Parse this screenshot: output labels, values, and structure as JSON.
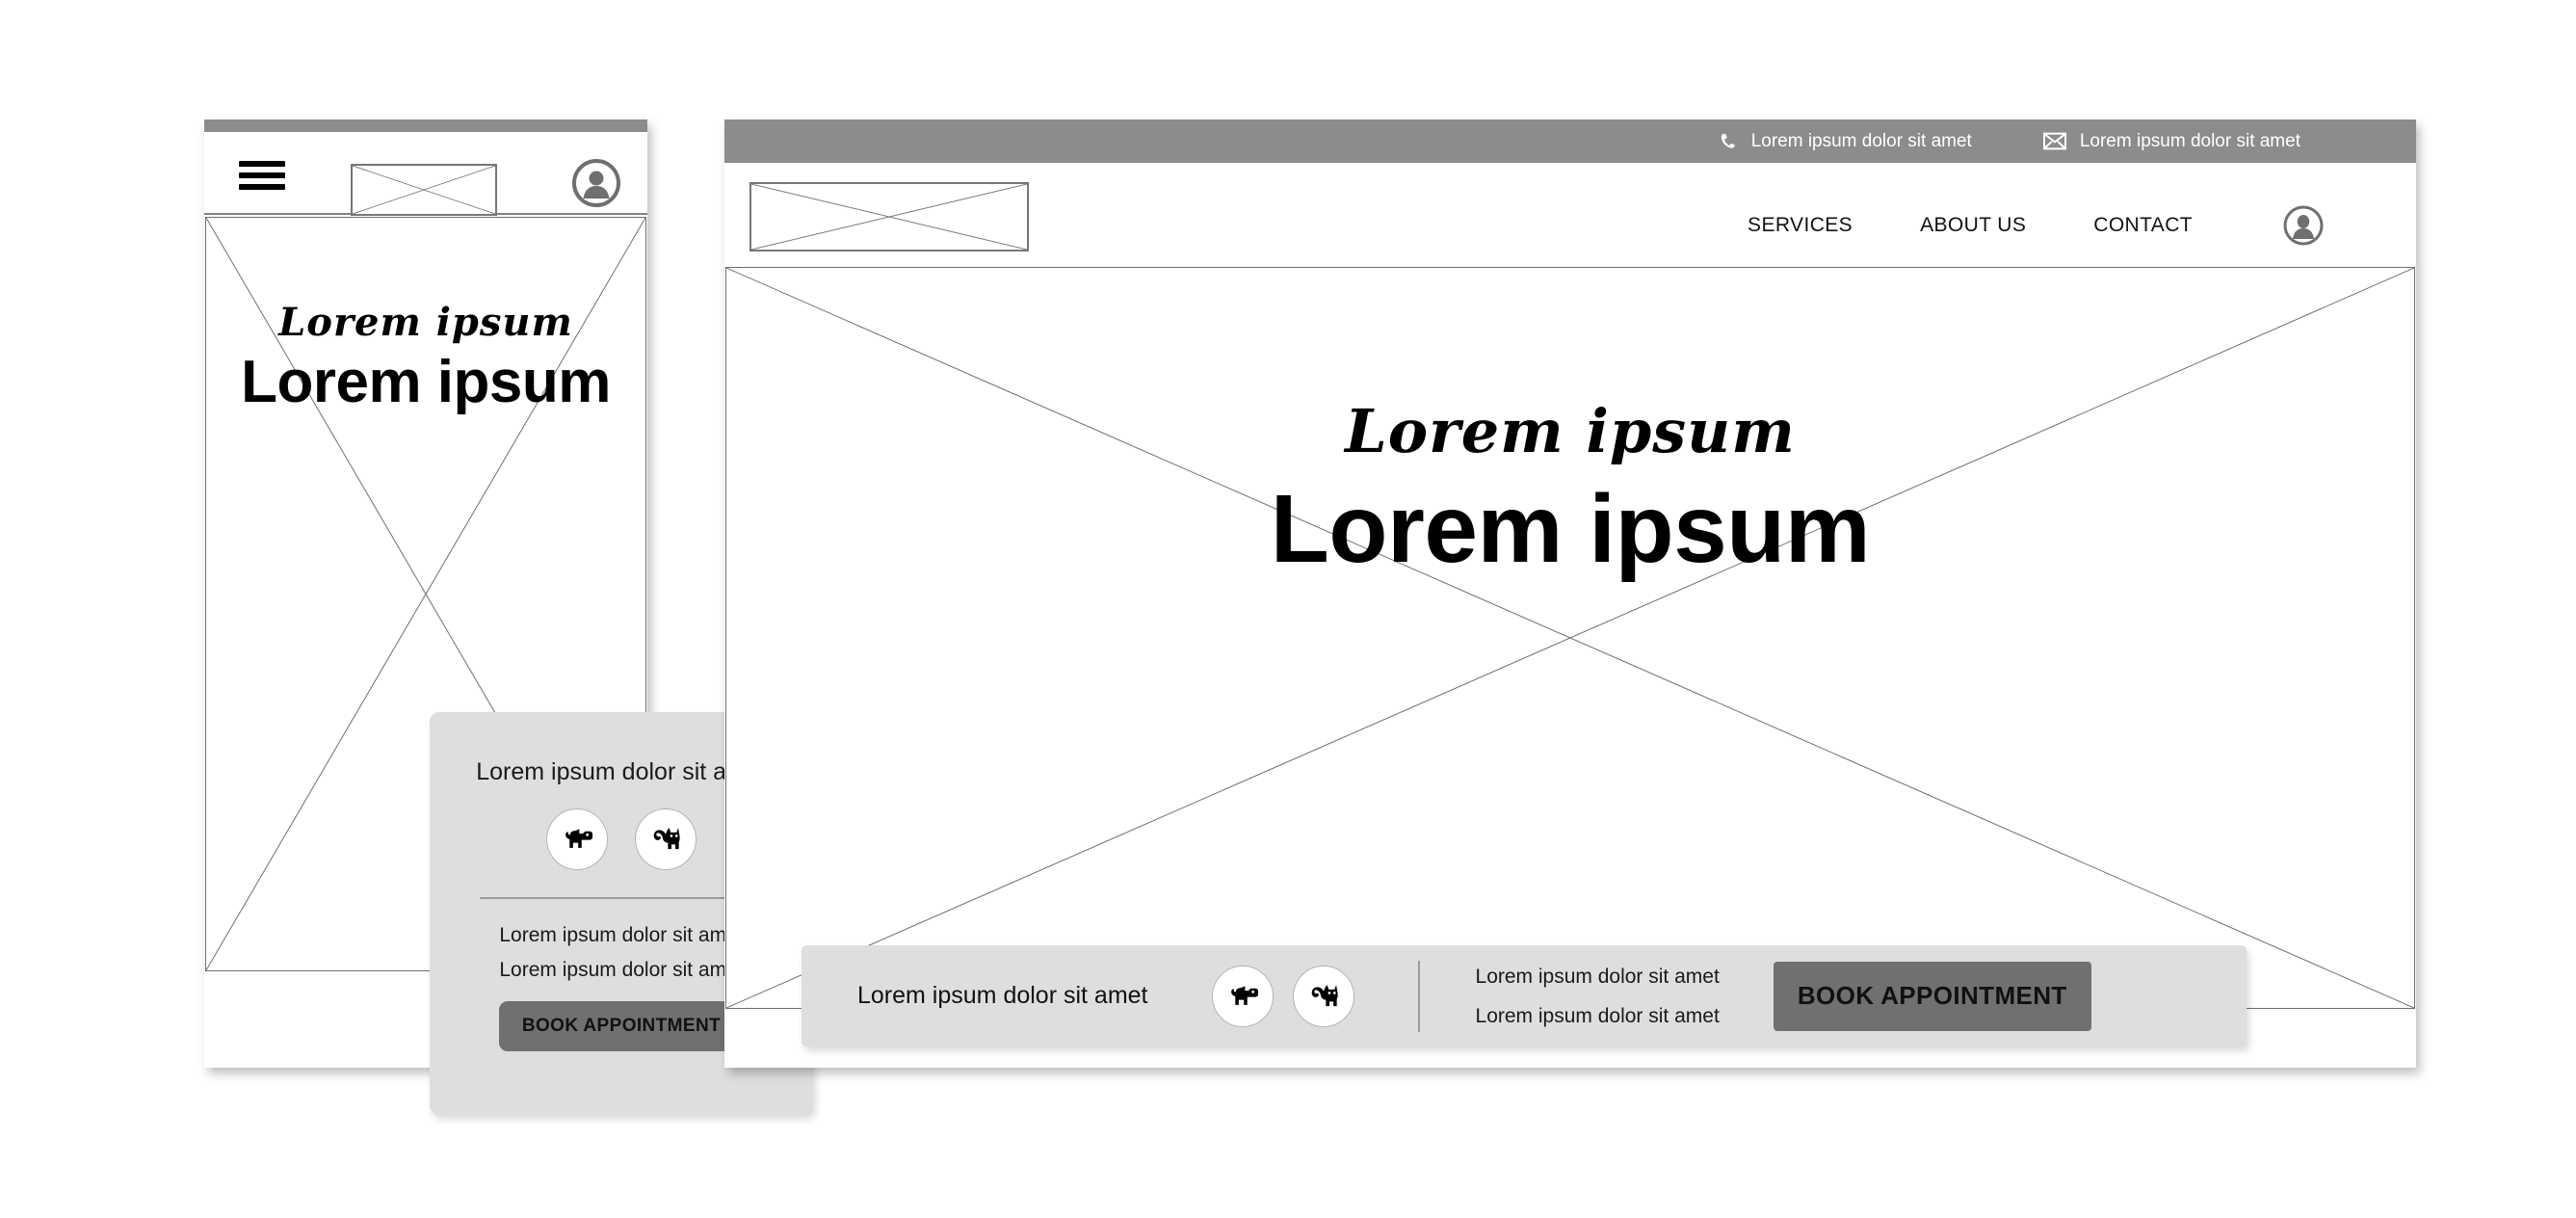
{
  "mobile": {
    "header": {
      "menu_icon": "hamburger-icon",
      "logo_placeholder": "image-placeholder",
      "avatar_icon": "user-avatar-icon"
    },
    "hero": {
      "script_heading": "Lorem ipsum",
      "bold_heading": "Lorem ipsum"
    },
    "card": {
      "title": "Lorem ipsum dolor sit amet",
      "pets": [
        {
          "icon": "dog-icon",
          "label": "Dog"
        },
        {
          "icon": "cat-icon",
          "label": "Cat"
        }
      ],
      "lines": [
        "Lorem ipsum dolor sit amet",
        "Lorem ipsum dolor sit amet"
      ],
      "book_button": "BOOK APPOINTMENT"
    }
  },
  "desktop": {
    "topbar": {
      "contacts": [
        {
          "icon": "phone-icon",
          "text": "Lorem ipsum dolor sit amet"
        },
        {
          "icon": "mail-icon",
          "text": "Lorem ipsum dolor sit amet"
        }
      ]
    },
    "navbar": {
      "logo_placeholder": "image-placeholder",
      "links": [
        "SERVICES",
        "ABOUT US",
        "CONTACT"
      ],
      "avatar_icon": "user-avatar-icon"
    },
    "hero": {
      "script_heading": "Lorem ipsum",
      "bold_heading": "Lorem ipsum"
    },
    "bottombar": {
      "title": "Lorem ipsum dolor sit amet",
      "pets": [
        {
          "icon": "dog-icon",
          "label": "Dog"
        },
        {
          "icon": "cat-icon",
          "label": "Cat"
        }
      ],
      "lines": [
        "Lorem ipsum dolor sit amet",
        "Lorem ipsum dolor sit amet"
      ],
      "book_button": "BOOK APPOINTMENT"
    }
  },
  "colors": {
    "topbar_gray": "#8c8c8c",
    "card_gray": "#dedede",
    "button_gray": "#707070",
    "outline_gray": "#6f6f6f",
    "page_background": "#ffffff"
  }
}
